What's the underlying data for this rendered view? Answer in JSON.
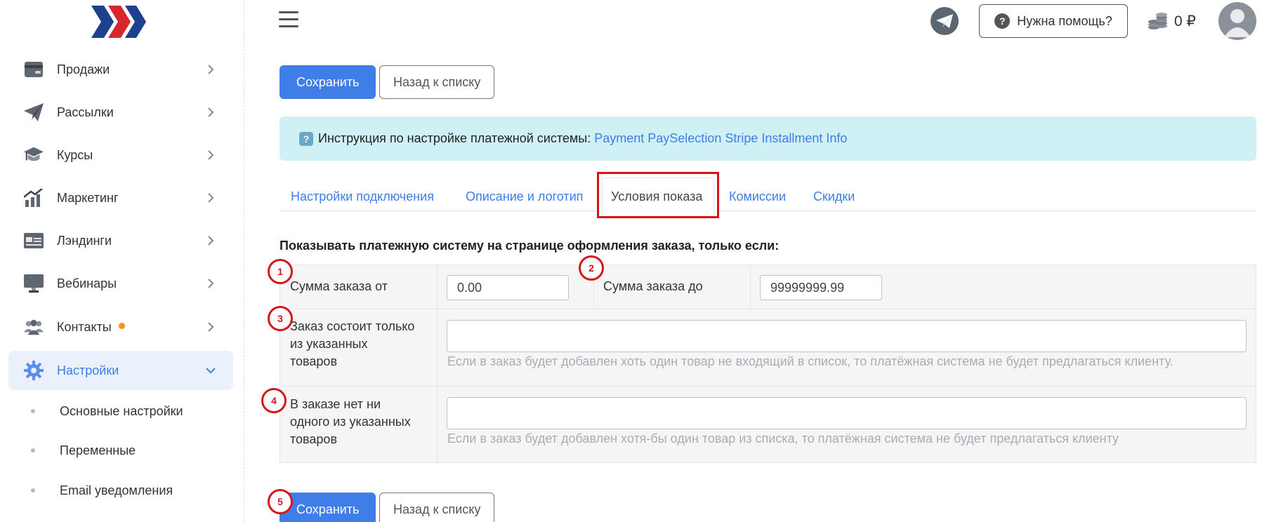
{
  "sidebar": {
    "items": [
      {
        "label": "Продажи",
        "icon": "wallet-icon"
      },
      {
        "label": "Рассылки",
        "icon": "paper-plane-icon"
      },
      {
        "label": "Курсы",
        "icon": "graduation-cap-icon"
      },
      {
        "label": "Маркетинг",
        "icon": "chart-growth-icon"
      },
      {
        "label": "Лэндинги",
        "icon": "landing-page-icon"
      },
      {
        "label": "Вебинары",
        "icon": "monitor-icon"
      },
      {
        "label": "Контакты",
        "icon": "users-icon",
        "badge_color": "#f7941d"
      },
      {
        "label": "Настройки",
        "icon": "gear-icon",
        "active": true
      }
    ],
    "subitems": [
      {
        "label": "Основные настройки"
      },
      {
        "label": "Переменные"
      },
      {
        "label": "Email уведомления"
      }
    ]
  },
  "header": {
    "help_label": "Нужна помощь?",
    "balance": "0 ₽"
  },
  "toolbar": {
    "save_label": "Сохранить",
    "back_label": "Назад к списку"
  },
  "alert": {
    "text": "Инструкция по настройке платежной системы:",
    "link": "Payment PaySelection Stripe Installment Info"
  },
  "tabs": [
    {
      "label": "Настройки подключения"
    },
    {
      "label": "Описание и логотип"
    },
    {
      "label": "Условия показа",
      "active": true
    },
    {
      "label": "Комиссии"
    },
    {
      "label": "Скидки"
    }
  ],
  "section_title": "Показывать платежную систему на странице оформления заказа, только если:",
  "conditions": {
    "sum_from_label": "Сумма заказа от",
    "sum_from_value": "0.00",
    "sum_to_label": "Сумма заказа до",
    "sum_to_value": "99999999.99",
    "only_items_label_1": "Заказ состоит только",
    "only_items_label_2": "из указанных",
    "only_items_label_3": "товаров",
    "only_items_hint": "Если в заказ будет добавлен хоть один товар не входящий в список, то платёжная система не будет предлагаться клиенту.",
    "none_items_label_1": "В заказе нет ни",
    "none_items_label_2": "одного из указанных",
    "none_items_label_3": "товаров",
    "none_items_hint": "Если в заказ будет добавлен хотя-бы один товар из списка, то платёжная система не будет предлагаться клиенту"
  },
  "markers": [
    "1",
    "2",
    "3",
    "4",
    "5"
  ],
  "colors": {
    "accent": "#3f7ee8",
    "marker": "#d7141a",
    "alert_bg": "#cff1f5"
  }
}
